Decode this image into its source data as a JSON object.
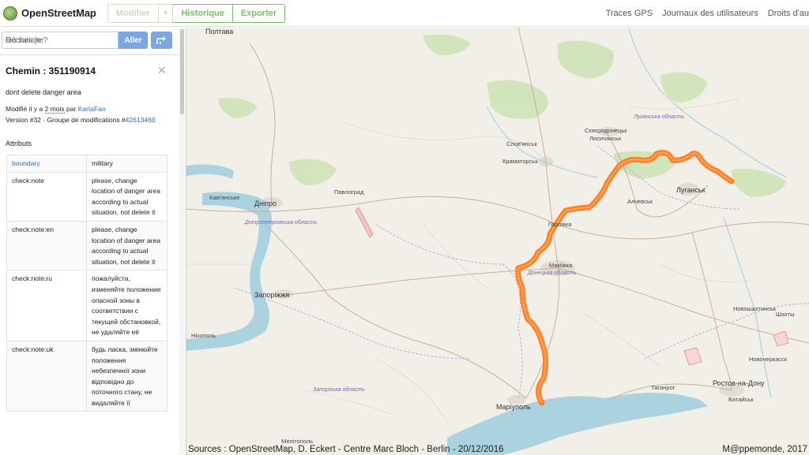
{
  "header": {
    "logo_text": "OpenStreetMap",
    "tabs": {
      "edit": "Modifier",
      "history": "Historique",
      "export": "Exporter"
    },
    "nav": {
      "traces": "Traces GPS",
      "diaries": "Journaux des utilisateurs",
      "rights": "Droits d'au"
    },
    "accent_color": "#7ebc6f"
  },
  "search": {
    "placeholder": "Recherche",
    "where_link": "Où suis-je ?",
    "go_label": "Aller",
    "directions_icon": "directions-icon"
  },
  "feature": {
    "title": "Chemin : 351190914",
    "comment": "dont delete danger area",
    "modified_prefix": "Modifié il y a",
    "modified_age": "2 mois",
    "modified_by": "par",
    "user": "KartaFan",
    "version_prefix": "Version #32 · Groupe de modifications #",
    "changeset": "42613460",
    "attributes_heading": "Attributs",
    "tags": [
      {
        "key": "boundary",
        "value": "military"
      },
      {
        "key": "check:note",
        "value": "please, change location of danger area according to actual situation, not delete it"
      },
      {
        "key": "check:note:en",
        "value": "please, change location of danger area according to actual situation, not delete it"
      },
      {
        "key": "check:note:ru",
        "value": "пожалуйста, изменяйте положение опасной зоны в соответствии с текущей обстановкой, не удаляйте её"
      },
      {
        "key": "check:note:uk",
        "value": "будь ласка, змінюйте положення небезпечної зони відповідно до поточного стану, не видаляйте її"
      }
    ]
  },
  "map": {
    "cities": {
      "poltava": "Полтава",
      "sumy": "",
      "lugansk": "Луганськ",
      "sievierodonetsk": "Сєвєродонецьк",
      "lysychansk": "Лисичанськ",
      "sloviansk": "Слов'янськ",
      "kramatorsk": "Краматорськ",
      "alchevsk": "Алчевськ",
      "horlivka": "Горлівка",
      "makiivka": "Макіївка",
      "pavlohrad": "Павлоград",
      "dnipro": "Дніпро",
      "kamianske": "Кам'янське",
      "zaporizhzhia": "Запоріжжя",
      "nikopol": "Нікополь",
      "mariupol": "Маріуполь",
      "taganrog": "Таганрог",
      "rostov": "Ростов-на-Дону",
      "bataisk": "Батайськ",
      "novocherkassk": "Новочеркасск",
      "shakhty": "Шахты",
      "novoshakhtinsk": "Новошахтинськ",
      "melitopol": "Мелітополь"
    },
    "regions": {
      "dnipro": "Дніпропетровська область",
      "donetsk": "Донецька область",
      "zaporizhzhia": "Запорізька область",
      "luhansk": "Луганська область"
    },
    "line_color": "#ff7a1a",
    "caption_left": "Sources : OpenStreetMap, D. Eckert - Centre Marc Bloch - Berlin - 20/12/2016",
    "caption_right": "M@ppemonde, 2017"
  }
}
